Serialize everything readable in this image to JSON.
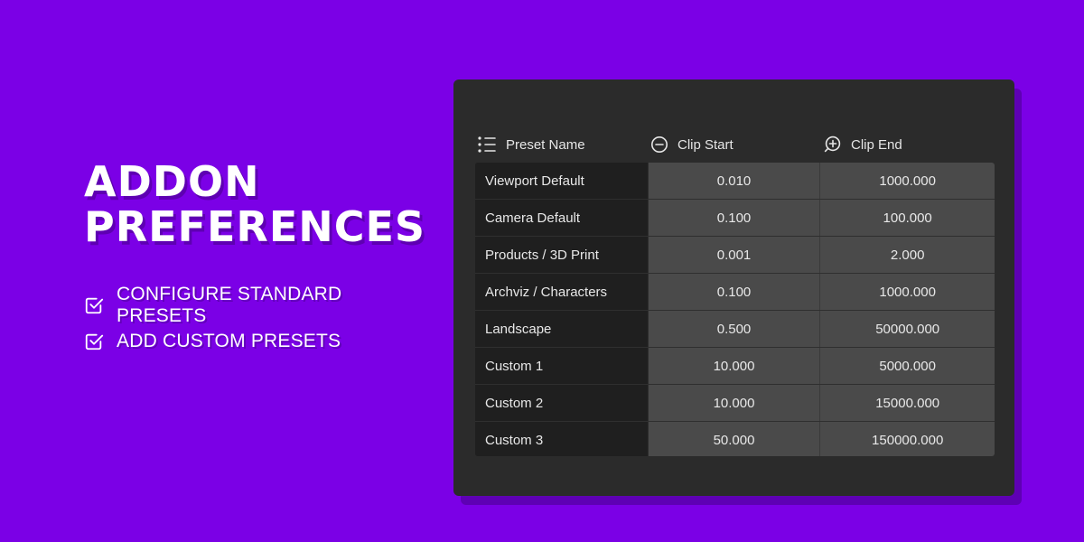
{
  "promo": {
    "title_line1": "ADDON",
    "title_line2": "PREFERENCES",
    "features": [
      {
        "label": "CONFIGURE STANDARD PRESETS",
        "icon": "checkbox-checked-icon"
      },
      {
        "label": "ADD CUSTOM PRESETS",
        "icon": "checkbox-checked-icon"
      }
    ]
  },
  "table": {
    "columns": [
      {
        "label": "Preset Name",
        "icon": "list-icon"
      },
      {
        "label": "Clip Start",
        "icon": "zoom-out-icon"
      },
      {
        "label": "Clip End",
        "icon": "zoom-in-icon"
      }
    ],
    "rows": [
      {
        "name": "Viewport Default",
        "clip_start": "0.010",
        "clip_end": "1000.000"
      },
      {
        "name": "Camera Default",
        "clip_start": "0.100",
        "clip_end": "100.000"
      },
      {
        "name": "Products / 3D Print",
        "clip_start": "0.001",
        "clip_end": "2.000"
      },
      {
        "name": "Archviz / Characters",
        "clip_start": "0.100",
        "clip_end": "1000.000"
      },
      {
        "name": "Landscape",
        "clip_start": "0.500",
        "clip_end": "50000.000"
      },
      {
        "name": "Custom 1",
        "clip_start": "10.000",
        "clip_end": "5000.000"
      },
      {
        "name": "Custom 2",
        "clip_start": "10.000",
        "clip_end": "15000.000"
      },
      {
        "name": "Custom 3",
        "clip_start": "50.000",
        "clip_end": "150000.000"
      }
    ]
  },
  "colors": {
    "background": "#7b00e6",
    "panel": "#2b2b2b",
    "name_cell": "#1f1f1f",
    "value_cell": "#4a4a4a",
    "text": "#e8e8e8"
  }
}
